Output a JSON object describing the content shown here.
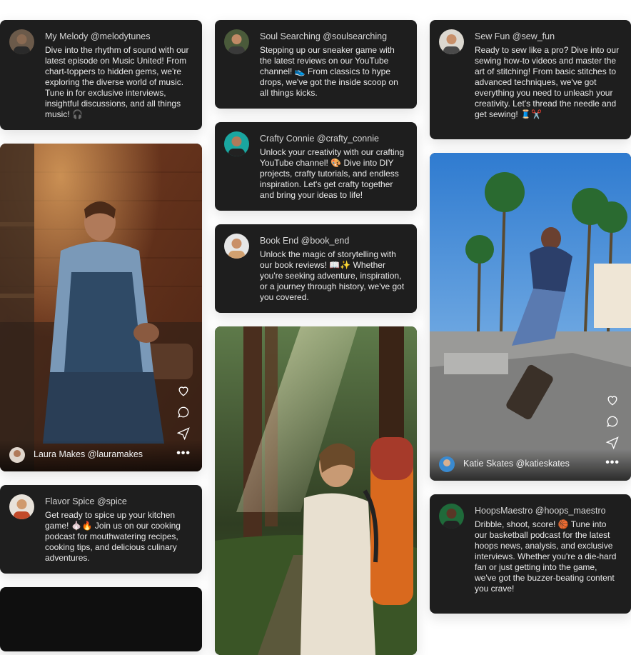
{
  "posts": [
    {
      "handle": "My Melody @melodytunes",
      "text": "Dive into the rhythm of sound with our latest episode on Music United! From chart-toppers to hidden gems, we're exploring the diverse world of music. Tune in for exclusive interviews, insightful discussions, and all things music! 🎧"
    },
    {
      "handle": "Soul Searching @soulsearching",
      "text": "Stepping up our sneaker game with the latest reviews on our YouTube channel! 👟 From classics to hype drops, we've got the inside scoop on all things kicks."
    },
    {
      "handle": "Sew Fun @sew_fun",
      "text": "Ready to sew like a pro? Dive into our sewing how-to videos and master the art of stitching! From basic stitches to advanced techniques, we've got everything you need to unleash your creativity. Let's thread the needle and get sewing! 🧵✂️"
    },
    {
      "handle": "Crafty Connie @crafty_connie",
      "text": "Unlock your creativity with our crafting YouTube channel! 🎨 Dive into DIY projects, crafty tutorials, and endless inspiration. Let's get crafty together and bring your ideas to life!"
    },
    {
      "handle": "Book End @book_end",
      "text": "Unlock the magic of storytelling with our book reviews! 📖✨ Whether you're seeking adventure, inspiration, or a journey through history, we've got you covered."
    },
    {
      "handle": "Flavor Spice @spice",
      "text": "Get ready to spice up your kitchen game! 🧄🔥 Join us on our cooking podcast for mouthwatering recipes, cooking tips, and delicious culinary adventures."
    },
    {
      "handle": "HoopsMaestro @hoops_maestro",
      "text": "Dribble, shoot, score! 🏀 Tune into our basketball podcast for the latest hoops news, analysis, and exclusive interviews. Whether you're a die-hard fan or just getting into the game, we've got the buzzer-beating content you crave!"
    }
  ],
  "media_posts": [
    {
      "label": "Laura Makes @lauramakes",
      "more": "•••"
    },
    {
      "label": "Katie Skates @katieskates",
      "more": "•••"
    }
  ],
  "icons": [
    "heart-icon",
    "comment-icon",
    "share-icon",
    "more-icon"
  ],
  "colors": {
    "card": "#1e1e1e",
    "text": "#eaeaea",
    "background": "#ffffff"
  }
}
